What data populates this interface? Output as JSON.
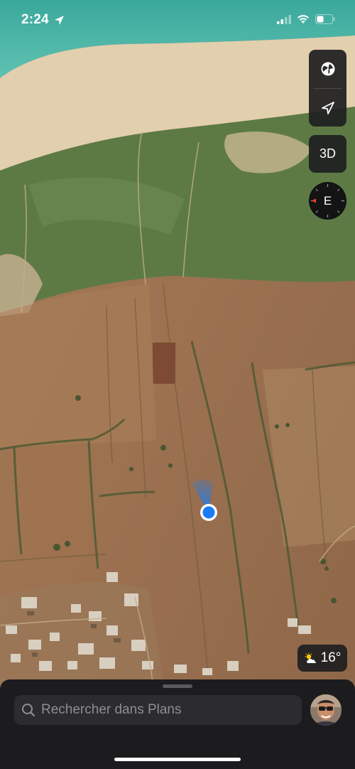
{
  "status_bar": {
    "time": "2:24"
  },
  "map": {
    "controls": {
      "map_mode_icon": "globe-icon",
      "location_icon": "location-arrow-icon",
      "view_3d_label": "3D",
      "compass_heading": "E"
    },
    "weather": {
      "icon": "partly-sunny-icon",
      "temperature": "16°"
    }
  },
  "search_sheet": {
    "placeholder": "Rechercher dans Plans"
  },
  "colors": {
    "user_location": "#1a7cf5",
    "panel_bg": "#1c1c1e",
    "search_bg": "#2c2c2e",
    "compass_marker": "#ff3b30"
  }
}
